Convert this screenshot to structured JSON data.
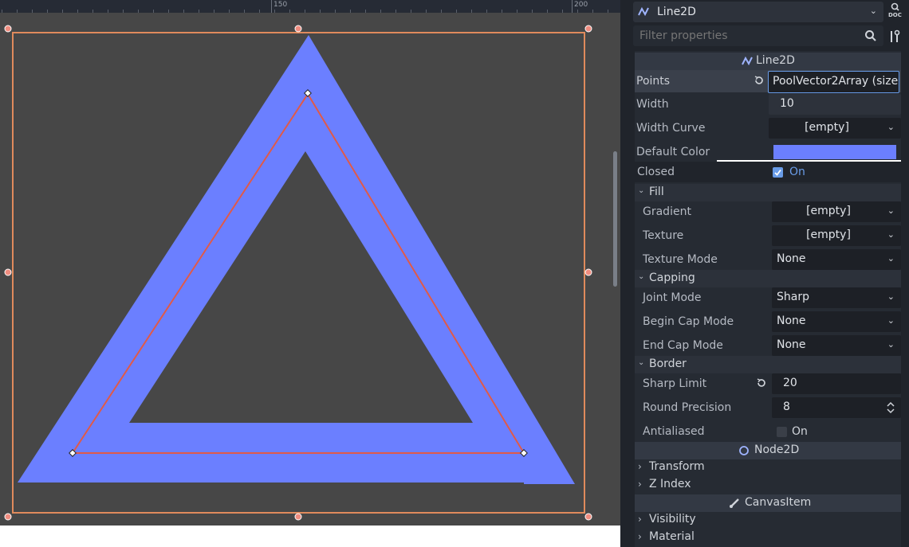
{
  "ruler": {
    "labels": [
      "150",
      "200"
    ]
  },
  "inspector": {
    "node_type": "Line2D",
    "doc_label": "DOC",
    "filter_placeholder": "Filter properties",
    "line2d_section": "Line2D",
    "props": {
      "points": {
        "label": "Points",
        "value": "PoolVector2Array (size"
      },
      "width": {
        "label": "Width",
        "value": "10"
      },
      "width_curve": {
        "label": "Width Curve",
        "value": "[empty]"
      },
      "default_color": {
        "label": "Default Color",
        "value": "#6b7fff"
      },
      "closed": {
        "label": "Closed",
        "value": "On"
      }
    },
    "fill": {
      "label": "Fill",
      "gradient": {
        "label": "Gradient",
        "value": "[empty]"
      },
      "texture": {
        "label": "Texture",
        "value": "[empty]"
      },
      "texture_mode": {
        "label": "Texture Mode",
        "value": "None"
      }
    },
    "capping": {
      "label": "Capping",
      "joint_mode": {
        "label": "Joint Mode",
        "value": "Sharp"
      },
      "begin_cap": {
        "label": "Begin Cap Mode",
        "value": "None"
      },
      "end_cap": {
        "label": "End Cap Mode",
        "value": "None"
      }
    },
    "border": {
      "label": "Border",
      "sharp_limit": {
        "label": "Sharp Limit",
        "value": "20"
      },
      "round_precision": {
        "label": "Round Precision",
        "value": "8"
      },
      "antialiased": {
        "label": "Antialiased",
        "value": "On"
      }
    },
    "node2d": {
      "label": "Node2D",
      "transform": "Transform",
      "z_index": "Z Index"
    },
    "canvas_item": {
      "label": "CanvasItem",
      "visibility": "Visibility",
      "material": "Material"
    }
  },
  "colors": {
    "line_fill": "#6b7fff",
    "selection": "#e08a5c",
    "path": "#e05a48",
    "accent": "#699ce8"
  }
}
